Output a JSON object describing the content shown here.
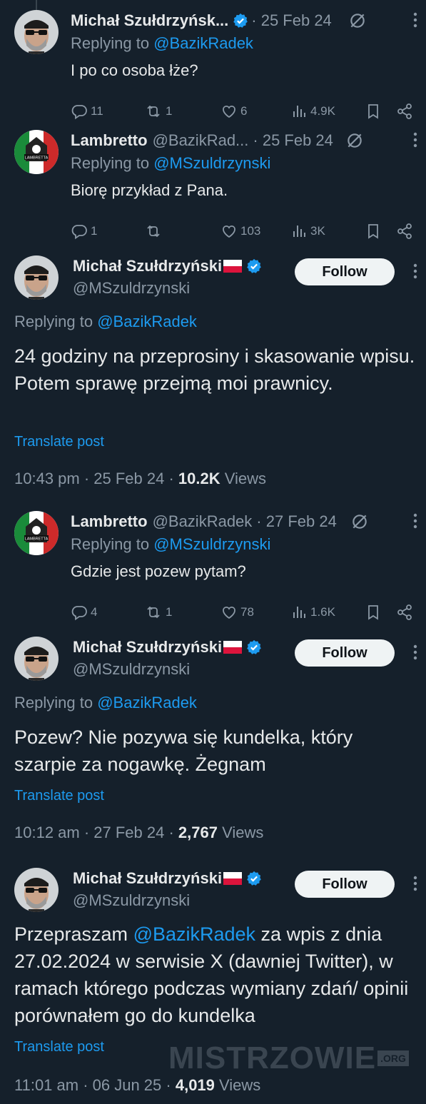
{
  "tweets": [
    {
      "name": "Michał Szułdrzyńsk...",
      "handle": "",
      "date": "· 25 Feb 24",
      "replying_prefix": "Replying to",
      "replying_to": "@BazikRadek",
      "text": "I po co osoba łże?",
      "replies": "11",
      "reposts": "1",
      "likes": "6",
      "views": "4.9K"
    },
    {
      "name": "Lambretto",
      "handle": "@BazikRad...",
      "date": "· 25 Feb 24",
      "replying_prefix": "Replying to",
      "replying_to": "@MSzuldrzynski",
      "text": "Biorę przykład z Pana.",
      "replies": "1",
      "reposts": "",
      "likes": "103",
      "views": "3K"
    },
    {
      "name": "Lambretto",
      "handle": "@BazikRadek",
      "date": "· 27 Feb 24",
      "replying_prefix": "Replying to",
      "replying_to": "@MSzuldrzynski",
      "text": "Gdzie jest pozew pytam?",
      "replies": "4",
      "reposts": "1",
      "likes": "78",
      "views": "1.6K"
    }
  ],
  "focused": [
    {
      "name": "Michał Szułdrzyński",
      "handle": "@MSzuldrzynski",
      "follow_label": "Follow",
      "replying_prefix": "Replying to",
      "replying_to": "@BazikRadek",
      "body": "24 godziny na przeprosiny i skasowanie wpisu. Potem sprawę przejmą moi prawnicy.",
      "translate": "Translate post",
      "time": "10:43 pm · 25 Feb 24 · ",
      "views_count": "10.2K",
      "views_label": " Views"
    },
    {
      "name": "Michał Szułdrzyński",
      "handle": "@MSzuldrzynski",
      "follow_label": "Follow",
      "replying_prefix": "Replying to",
      "replying_to": "@BazikRadek",
      "body": "Pozew? Nie pozywa się kundelka, który szarpie za nogawkę. Żegnam",
      "translate": "Translate post",
      "time": "10:12 am · 27 Feb 24 · ",
      "views_count": "2,767",
      "views_label": " Views"
    },
    {
      "name": "Michał Szułdrzyński",
      "handle": "@MSzuldrzynski",
      "follow_label": "Follow",
      "body_mention": "@BazikRadek",
      "body_pre": "Przepraszam ",
      "body_post": " za wpis z dnia 27.02.2024 w serwisie X (dawniej Twitter), w ramach którego podczas wymiany zdań/ opinii porównałem go do kundelka",
      "translate": "Translate post",
      "time": "11:01 am · 06 Jun 25 · ",
      "views_count": "4,019",
      "views_label": " Views"
    }
  ],
  "watermark": {
    "text": "MISTRZOWIE",
    "suffix": ".ORG"
  },
  "colors": {
    "background": "#15202b",
    "accent": "#1d9bf0",
    "muted": "#8b98a5",
    "verified": "#1d9bf0"
  },
  "icons": [
    "reply-icon",
    "repost-icon",
    "like-icon",
    "views-icon",
    "bookmark-icon",
    "share-icon",
    "grok-icon",
    "more-icon",
    "verified-badge-icon",
    "poland-flag-icon"
  ]
}
